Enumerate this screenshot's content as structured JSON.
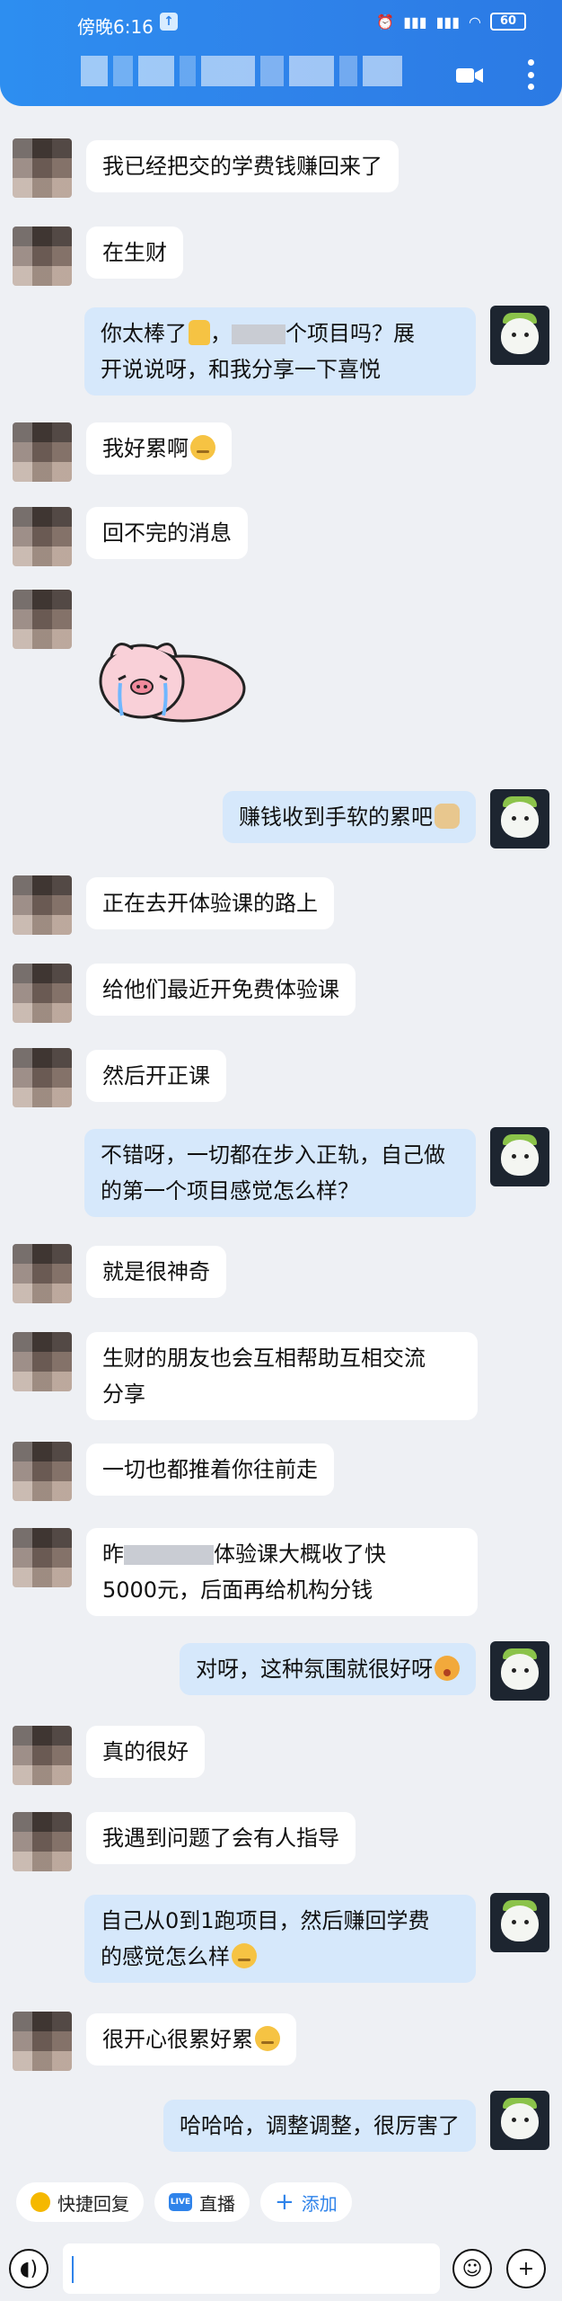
{
  "status_bar": {
    "time": "傍晚6:16",
    "battery": "60"
  },
  "messages": [
    {
      "side": "left",
      "text": "我已经把交的学费钱赚回来了"
    },
    {
      "side": "left",
      "text": "在生财"
    },
    {
      "side": "right",
      "line1_pre": "你太棒了",
      "line1_post": "个项目吗？展",
      "line2": "开说说呀，和我分享一下喜悦"
    },
    {
      "side": "left",
      "text": "我好累啊"
    },
    {
      "side": "left",
      "text": "回不完的消息"
    },
    {
      "side": "right",
      "text": "赚钱收到手软的累吧"
    },
    {
      "side": "left",
      "text": "正在去开体验课的路上"
    },
    {
      "side": "left",
      "text": "给他们最近开免费体验课"
    },
    {
      "side": "left",
      "text": "然后开正课"
    },
    {
      "side": "right",
      "line1": "不错呀，一切都在步入正轨，自己做",
      "line2": "的第一个项目感觉怎么样？"
    },
    {
      "side": "left",
      "text": "就是很神奇"
    },
    {
      "side": "left",
      "line1": "生财的朋友也会互相帮助互相交流",
      "line2": "分享"
    },
    {
      "side": "left",
      "text": "一切也都推着你往前走"
    },
    {
      "side": "left",
      "line1_pre": "昨",
      "line1_post": "体验课大概收了快",
      "line2": "5000元，后面再给机构分钱"
    },
    {
      "side": "right",
      "text": "对呀，这种氛围就很好呀"
    },
    {
      "side": "left",
      "text": "真的很好"
    },
    {
      "side": "left",
      "text": "我遇到问题了会有人指导"
    },
    {
      "side": "right",
      "line1": "自己从0到1跑项目，然后赚回学费",
      "line2": "的感觉怎么样"
    },
    {
      "side": "left",
      "text": "很开心很累好累"
    },
    {
      "side": "right",
      "text": "哈哈哈，调整调整，很厉害了"
    }
  ],
  "quick_actions": {
    "quick_reply": "快捷回复",
    "live_badge": "LIVE",
    "live": "直播",
    "add": "添加"
  },
  "colors": {
    "accent": "#2f83ea",
    "bubble_right": "#d6e8fb",
    "bubble_left": "#ffffff",
    "background": "#eef0f4"
  }
}
